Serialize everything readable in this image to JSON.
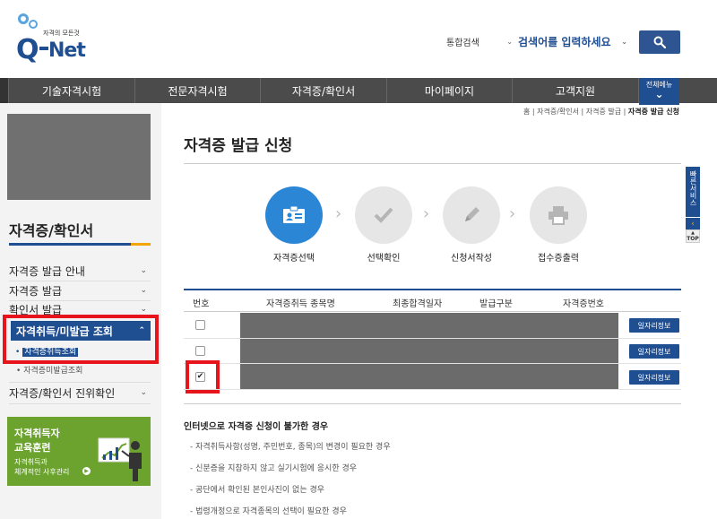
{
  "header": {
    "logo_tagline": "자격의 모든것",
    "logo_q": "Q",
    "logo_net": "Net",
    "search_category": "통합검색",
    "search_placeholder": "검색어를 입력하세요"
  },
  "gnb": {
    "items": [
      "기술자격시험",
      "전문자격시험",
      "자격증/확인서",
      "마이페이지",
      "고객지원"
    ],
    "all_menu": "전체메뉴"
  },
  "sidebar": {
    "title": "자격증/확인서",
    "menu": [
      {
        "label": "자격증 발급 안내"
      },
      {
        "label": "자격증 발급"
      },
      {
        "label": "확인서 발급"
      }
    ],
    "active": "자격취득/미발급 조회",
    "sub_active": "자격증취득조회",
    "sub_item": "자격증미발급조회",
    "last_menu": "자격증/확인서 진위확인",
    "banner": {
      "line1": "자격취득자",
      "line2": "교육훈련",
      "line3": "자격취득과",
      "line4": "체계적인 사후관리"
    }
  },
  "breadcrumb": {
    "home": "홈",
    "sep": "|",
    "b1": "자격증/확인서",
    "b2": "자격증 발급",
    "current": "자격증 발급 신청"
  },
  "main": {
    "title": "자격증 발급 신청",
    "steps": [
      {
        "label": "자격증선택",
        "icon": "id-card-icon",
        "active": true
      },
      {
        "label": "선택확인",
        "icon": "check-icon",
        "active": false
      },
      {
        "label": "신청서작성",
        "icon": "pencil-icon",
        "active": false
      },
      {
        "label": "접수증출력",
        "icon": "printer-icon",
        "active": false
      }
    ],
    "table": {
      "headers": [
        "번호",
        "자격증취득 종목명",
        "최종합격일자",
        "발급구분",
        "자격증번호"
      ],
      "rows": [
        {
          "checked": false,
          "button": "일자리정보"
        },
        {
          "checked": false,
          "button": "일자리정보"
        },
        {
          "checked": true,
          "button": "일자리정보"
        }
      ]
    },
    "notice": {
      "title": "인터넷으로 자격증 신청이 불가한 경우",
      "items": [
        "- 자격취득사항(성명, 주민번호, 종목)의 변경이 필요한 경우",
        "- 신분증을 지참하지 않고 실기시험에 응시한 경우",
        "- 공단에서 확인된 본인사진이 없는 경우",
        "- 법령개정으로 자격종목의 선택이 필요한 경우"
      ]
    }
  },
  "quick": {
    "label": "빠른서비스",
    "top": "TOP"
  },
  "colors": {
    "brand": "#1f4e91",
    "highlight": "#e8141b",
    "nav": "#4b4b4b",
    "banner": "#6ba32e"
  }
}
